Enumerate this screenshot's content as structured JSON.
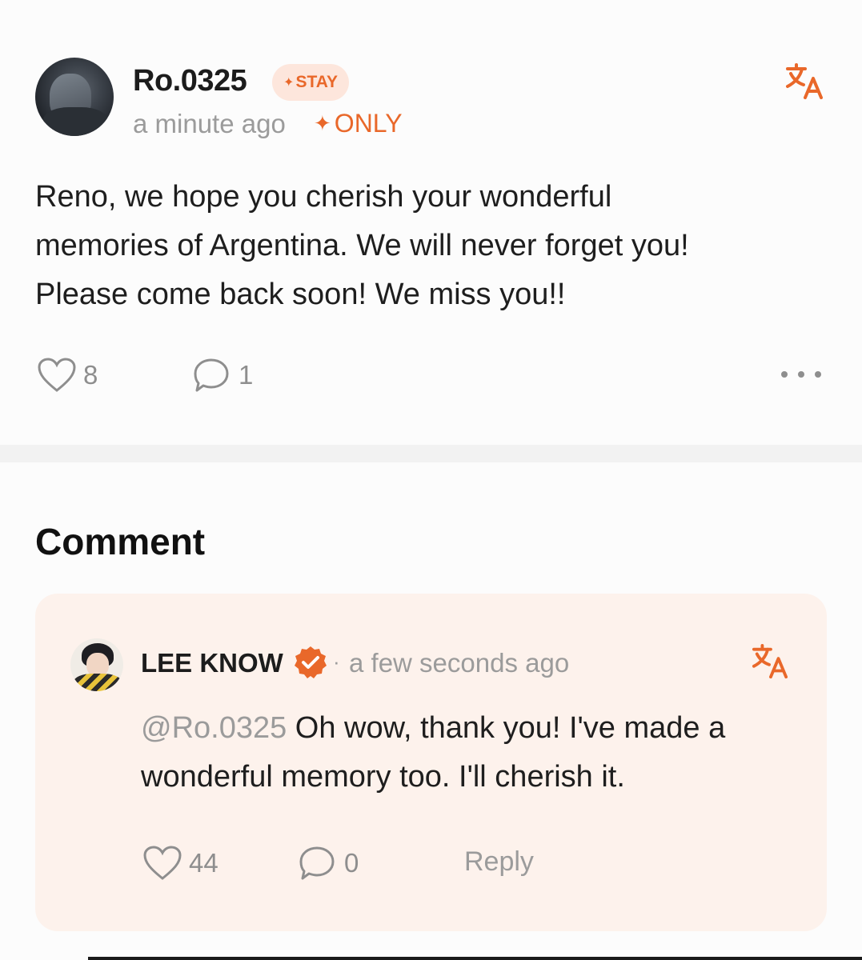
{
  "post": {
    "author": "Ro.0325",
    "badge": "STAY",
    "badge_spark": "✦",
    "time": "a minute ago",
    "only_label": "ONLY",
    "only_spark": "✦",
    "lines": [
      "Reno, we hope you cherish your wonderful",
      "memories of Argentina. We will never forget you!",
      "Please come back soon! We miss you!!"
    ],
    "like_count": "8",
    "comment_count": "1",
    "icons": {
      "avatar": "user-avatar",
      "translate": "translate-icon",
      "like": "heart-icon",
      "comment": "comment-bubble-icon",
      "more": "more-dots-icon"
    }
  },
  "comments": {
    "title": "Comment",
    "items": [
      {
        "author": "LEE KNOW",
        "separator": "·",
        "time": "a few seconds ago",
        "mention": "@Ro.0325",
        "lines": [
          " Oh wow, thank you! I've made a",
          "wonderful memory too. I'll cherish it."
        ],
        "like_count": "44",
        "comment_count": "0",
        "reply_label": "Reply",
        "icons": {
          "verified": "verified-badge-icon",
          "translate": "translate-icon",
          "like": "heart-icon",
          "comment": "comment-bubble-icon"
        }
      }
    ]
  },
  "colors": {
    "accent": "#e9682a",
    "badge_bg": "#fde6dc",
    "card_bg": "#fdf2ec",
    "muted": "#9b9b9b",
    "text": "#1e1e1e"
  }
}
